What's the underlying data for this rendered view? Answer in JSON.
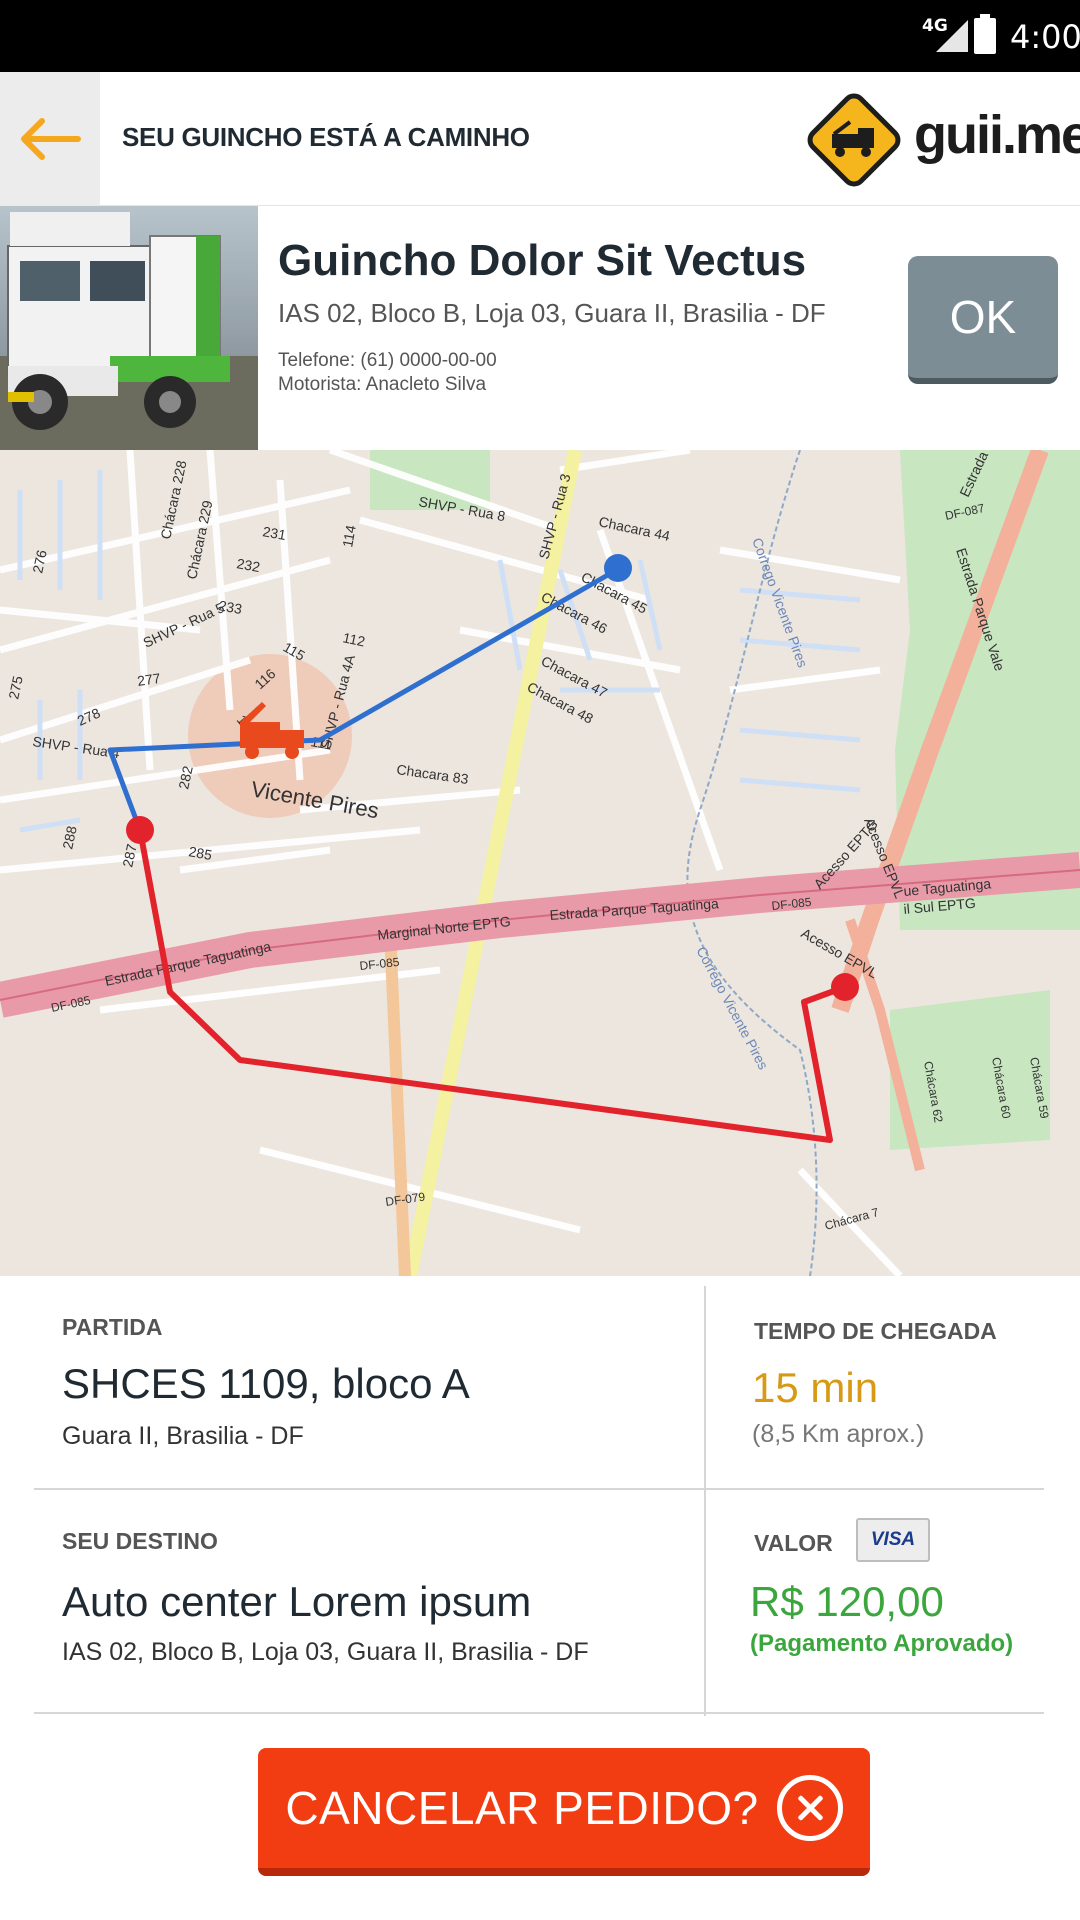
{
  "status_bar": {
    "network": "4G",
    "time": "4:00"
  },
  "header": {
    "title": "SEU GUINCHO ESTÁ A CAMINHO",
    "logo_text": "guii.me"
  },
  "tow_service": {
    "name": "Guincho Dolor Sit Vectus",
    "address": "IAS 02, Bloco B, Loja 03,  Guara II, Brasilia - DF",
    "phone": "Telefone: (61) 0000-00-00",
    "driver": "Motorista: Anacleto Silva",
    "ok_label": "OK"
  },
  "map": {
    "labels": {
      "shvp_rua8": "SHVP - Rua 8",
      "shvp_rua3": "SHVP - Rua 3",
      "shvp_rua5": "SHVP - Rua 5",
      "shvp_rua4": "SHVP - Rua 4",
      "shvp_rua4a": "SHVP - Rua 4A",
      "chacara44": "Chacara 44",
      "chacara45": "Chacara 45",
      "chacara46": "Chacara 46",
      "chacara47": "Chacara 47",
      "chacara48": "Chacara 48",
      "chacara83": "Chacara 83",
      "chacara228": "Chácara 228",
      "chacara229": "Chácara 229",
      "vicente_pires": "Vicente Pires",
      "marginal_norte": "Marginal Norte EPTG",
      "estrada_taguatinga": "Estrada Parque Taguatinga",
      "estrada_taguatinga_left": "Estrada Parque Taguatinga",
      "df085_a": "DF-085",
      "df085_b": "DF-085",
      "df085_c": "DF-085",
      "df087": "DF-087",
      "df079": "DF-079",
      "estrada_vale": "Estrada Parque Vale",
      "estrada_par": "Estrada Par",
      "acesso_eptg": "Acesso EPTG",
      "acesso_epvl": "Acesso EPVL",
      "acesso_epvl2": "Acesso EPVL",
      "ue_taguatinga": "ue Taguatinga",
      "il_sul_eptg": "il Sul EPTG",
      "corrego_vp": "Corrego Vicente Pires",
      "corrego_vp2": "Corrego Vicente Pires",
      "chacara7": "Chácara 7",
      "chacara62": "Chácara 62",
      "chacara60": "Chácara 60",
      "chacara59": "Chácara 59",
      "n231": "231",
      "n232": "232",
      "n233": "233",
      "n276": "276",
      "n277": "277",
      "n278": "278",
      "n275": "275",
      "n114": "114",
      "n112": "112",
      "n115": "115",
      "n116": "116",
      "n117": "117",
      "n111": "111",
      "n282": "282",
      "n288": "288",
      "n285": "285",
      "n287": "287"
    }
  },
  "trip": {
    "origin_label": "PARTIDA",
    "origin_main": "SHCES 1109, bloco A",
    "origin_sub": "Guara II, Brasilia - DF",
    "arrival_label": "TEMPO DE CHEGADA",
    "arrival_time": "15 min",
    "arrival_distance": "(8,5 Km aprox.)",
    "destination_label": "SEU DESTINO",
    "destination_main": "Auto center Lorem ipsum",
    "destination_sub": "IAS 02, Bloco B, Loja 03,  Guara II, Brasilia - DF",
    "price_label": "VALOR",
    "card_brand": "VISA",
    "price": "R$ 120,00",
    "payment_status": "(Pagamento Aprovado)"
  },
  "cancel": {
    "label": "CANCELAR PEDIDO?"
  },
  "colors": {
    "accent_orange": "#f23d12",
    "arrival_time": "#d79a16",
    "price_green": "#3ca63e",
    "route_red": "#e3232b",
    "route_blue": "#2e6fcf",
    "logo_yellow": "#f5b51d"
  },
  "icons": {
    "back": "arrow-left-icon",
    "logo": "tow-truck-diamond-icon",
    "tow_marker": "tow-truck-icon",
    "cancel": "close-circle-icon"
  }
}
